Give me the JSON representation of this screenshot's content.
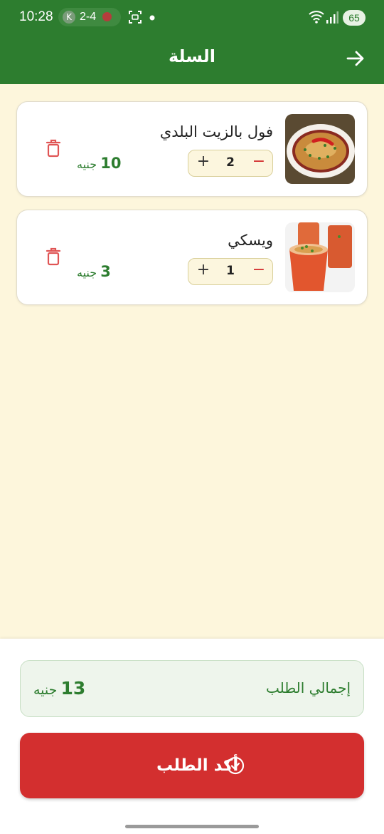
{
  "status_bar": {
    "time": "10:28",
    "badge_letter": "K",
    "score": "2-4",
    "battery": "65"
  },
  "app_bar": {
    "title": "السلة",
    "back_icon": "arrow-right-icon"
  },
  "cart": {
    "items": [
      {
        "name": "فول بالزيت البلدي",
        "quantity": "2",
        "price": "10",
        "currency": "جنيه",
        "image": "foul-dish"
      },
      {
        "name": "ويسكي",
        "quantity": "1",
        "price": "3",
        "currency": "جنيه",
        "image": "drink-cups"
      }
    ]
  },
  "summary": {
    "total_label": "إجمالي الطلب",
    "total_value": "13",
    "currency": "جنيه"
  },
  "confirm_button": {
    "label": "أكد الطلب"
  },
  "colors": {
    "primary_green": "#2d7d2f",
    "background_cream": "#fdf6dc",
    "danger_red": "#d32f2f"
  }
}
